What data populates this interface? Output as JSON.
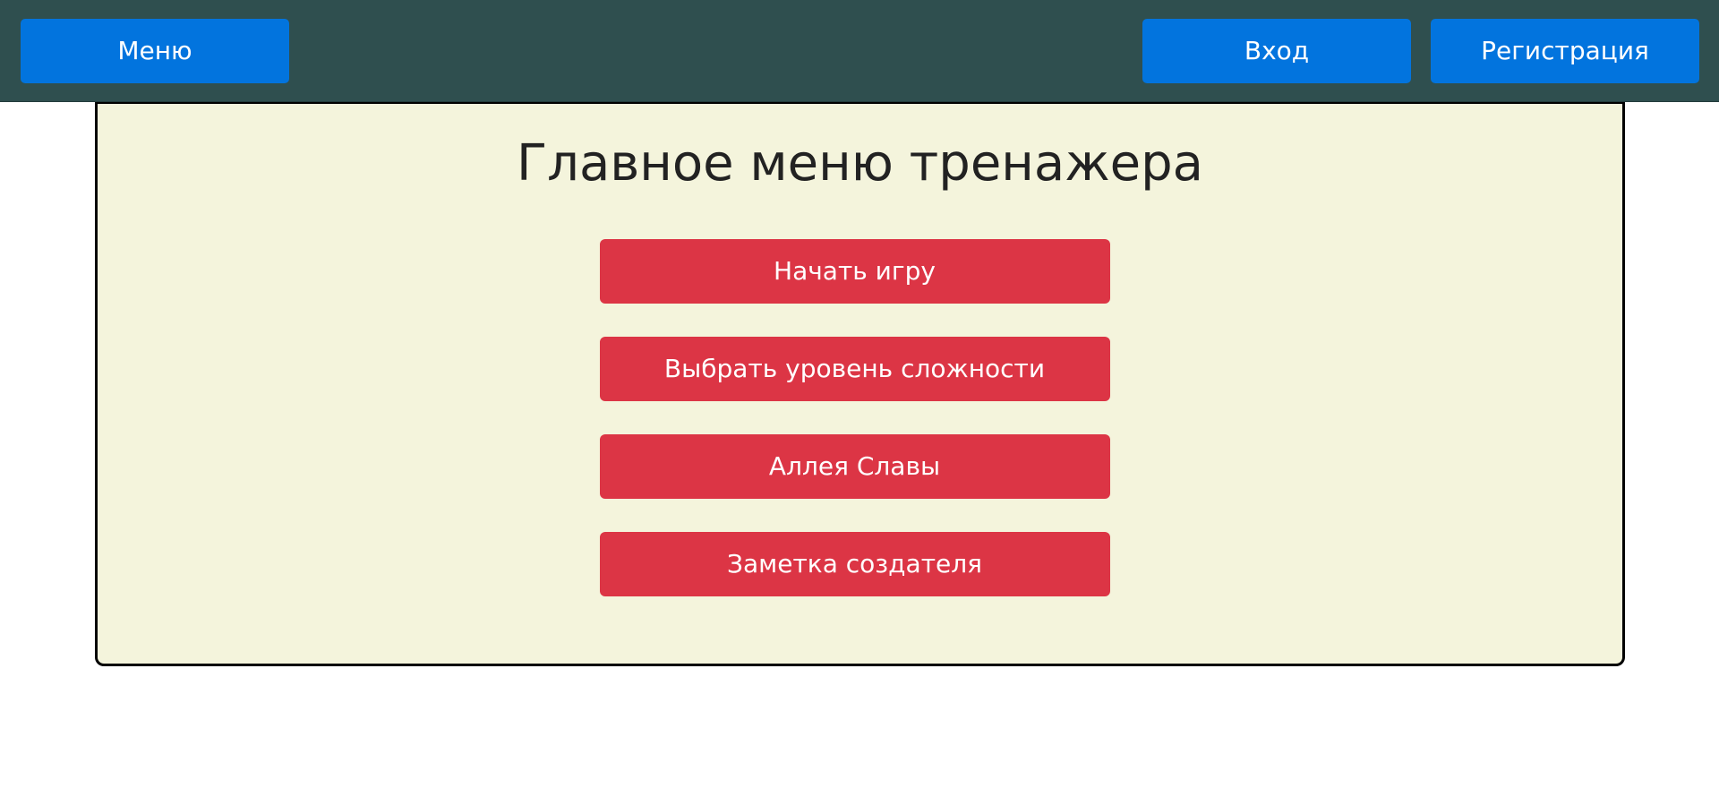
{
  "header": {
    "menu_label": "Меню",
    "login_label": "Вход",
    "register_label": "Регистрация"
  },
  "main": {
    "title": "Главное меню тренажера",
    "buttons": [
      {
        "label": "Начать игру"
      },
      {
        "label": "Выбрать уровень сложности"
      },
      {
        "label": "Аллея Славы"
      },
      {
        "label": "Заметка создателя"
      }
    ]
  },
  "colors": {
    "topbar": "#2f4f4f",
    "nav_button": "#0274de",
    "panel_bg": "#f4f4dc",
    "menu_button": "#dc3545"
  }
}
